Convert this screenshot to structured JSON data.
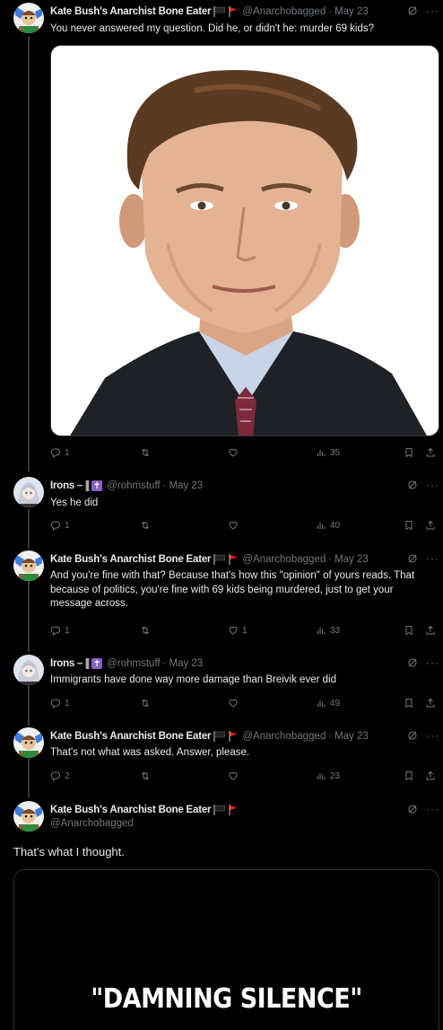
{
  "tweets": [
    {
      "name": "Kate Bush's Anarchist Bone Eater",
      "handle": "@Anarchobagged",
      "date": "May 23",
      "text": "You never answered my question. Did he, or didn't he: murder 69 kids?",
      "replies": "1",
      "retweets": "",
      "likes": "",
      "views": "35"
    },
    {
      "name": "Irons",
      "handle": "@rohmstuff",
      "date": "May 23",
      "text": "Yes he did",
      "replies": "1",
      "retweets": "",
      "likes": "",
      "views": "40"
    },
    {
      "name": "Kate Bush's Anarchist Bone Eater",
      "handle": "@Anarchobagged",
      "date": "May 23",
      "text": "And you're fine with that? Because that's how this \"opinion\" of yours reads. That because of politics, you're fine with 69 kids being murdered, just to get your message across.",
      "replies": "1",
      "retweets": "",
      "likes": "1",
      "views": "33"
    },
    {
      "name": "Irons",
      "handle": "@rohmstuff",
      "date": "May 23",
      "text": "Immigrants have done way more damage than Breivik ever did",
      "replies": "1",
      "retweets": "",
      "likes": "",
      "views": "49"
    },
    {
      "name": "Kate Bush's Anarchist Bone Eater",
      "handle": "@Anarchobagged",
      "date": "May 23",
      "text": "That's not what was asked. Answer, please.",
      "replies": "2",
      "retweets": "",
      "likes": "",
      "views": "23"
    }
  ],
  "main_tweet": {
    "name": "Kate Bush's Anarchist Bone Eater",
    "handle": "@Anarchobagged",
    "text": "That's what I thought.",
    "image_caption": "\"DAMNING SILENCE\""
  },
  "date_separator": "·",
  "more_label": "···",
  "colors": {
    "background": "#000000",
    "text": "#e7e9ea",
    "muted": "#71767b",
    "line": "#333639",
    "red_flag": "#f91818"
  }
}
